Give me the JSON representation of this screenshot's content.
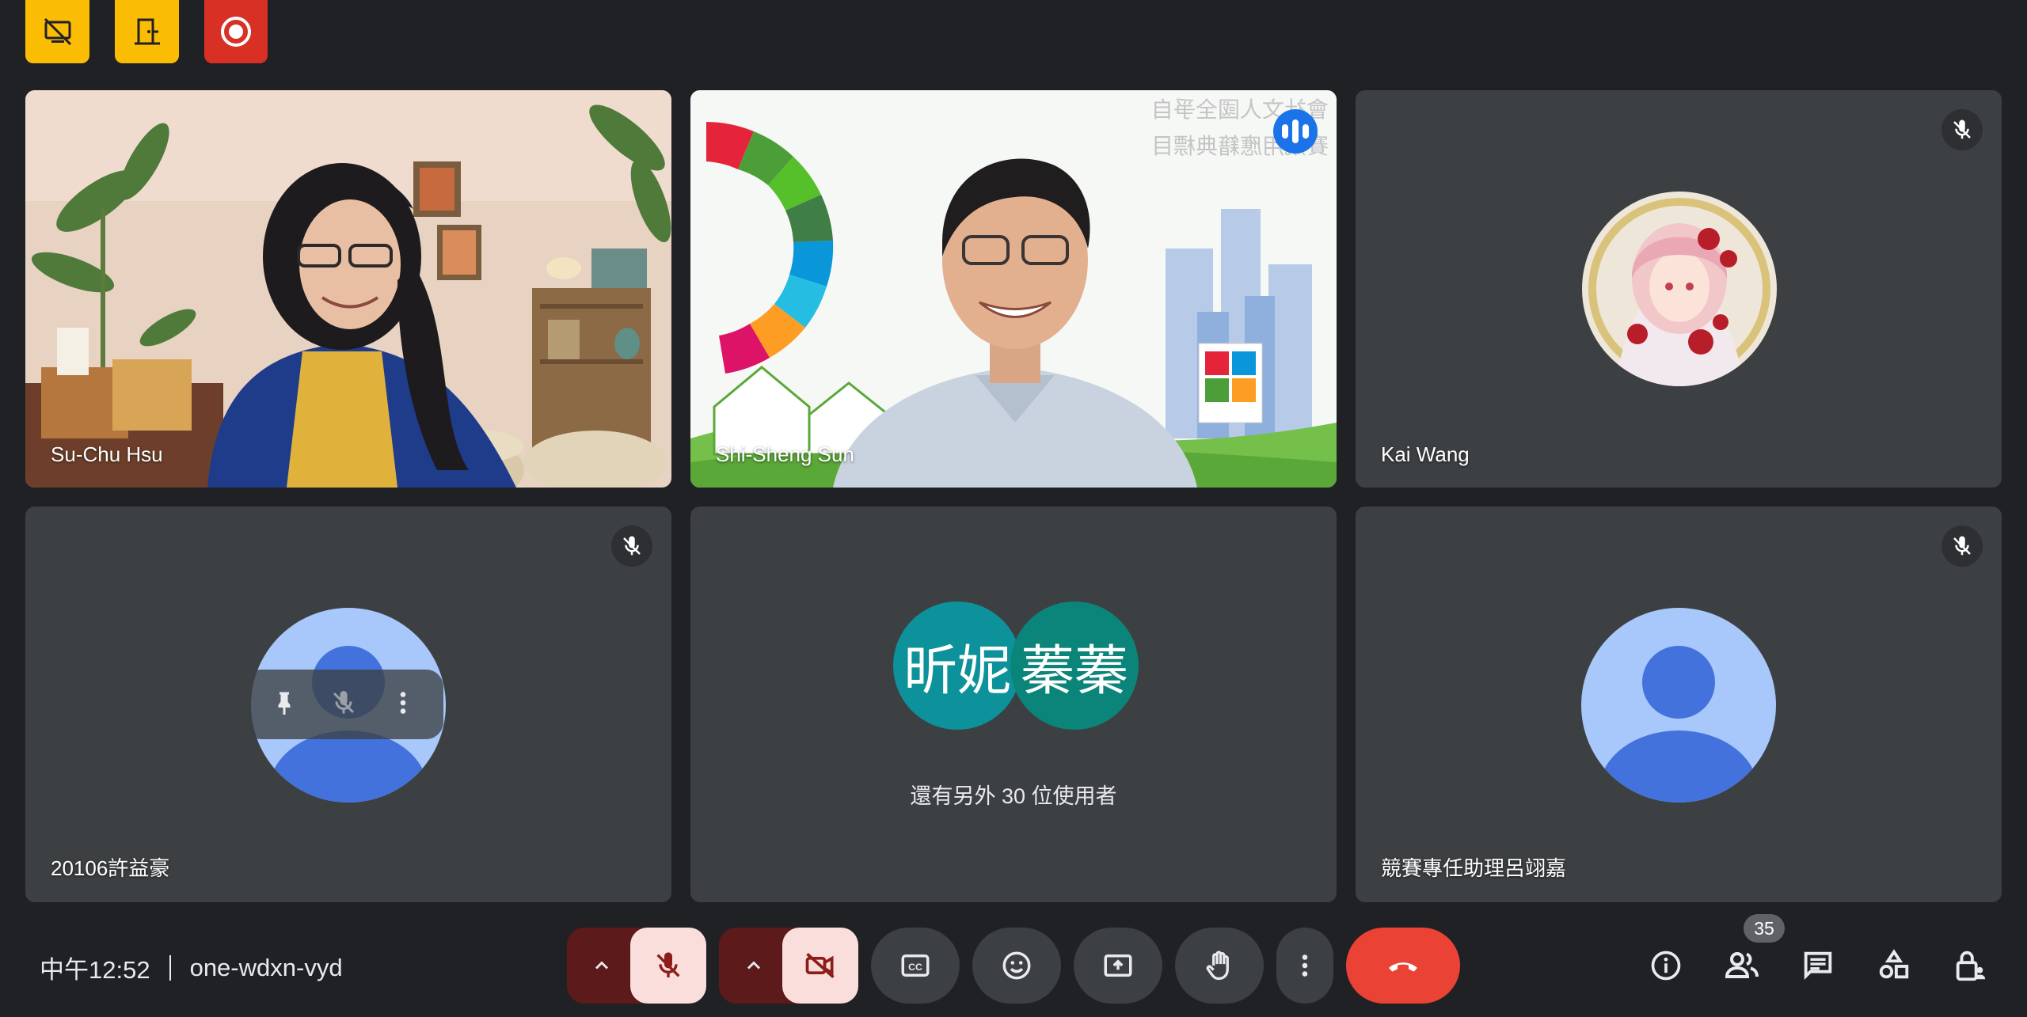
{
  "meeting": {
    "time": "中午12:52",
    "code": "one-wdxn-vyd",
    "participant_count": "35"
  },
  "indicators": [
    {
      "icon": "no-screen-share-icon",
      "color": "#fbbc04"
    },
    {
      "icon": "host-controls-icon",
      "color": "#fbbc04"
    },
    {
      "icon": "recording-icon",
      "color": "#d93025"
    }
  ],
  "tiles": {
    "t1": {
      "name": "Su-Chu Hsu"
    },
    "t2": {
      "name": "Shi-Sheng Sun",
      "speaking": true,
      "backdrop_text": [
        "會社文人國全爭自",
        "賽競用應籍典標目"
      ]
    },
    "t3": {
      "name": "Kai Wang",
      "muted": true
    },
    "t4": {
      "name": "20106許益豪",
      "muted": true
    },
    "t5": {
      "initials": [
        "昕妮",
        "蓁蓁"
      ],
      "others_label": "還有另外 30 位使用者"
    },
    "t6": {
      "name": "競賽專任助理呂翊嘉",
      "muted": true
    }
  },
  "controls": {
    "mic": "microphone-muted",
    "camera": "camera-off",
    "captions": "closed-captions",
    "reactions": "emoji",
    "present": "present-screen",
    "raise_hand": "raise-hand",
    "more": "more-options",
    "leave": "leave-call"
  },
  "colors": {
    "background": "#202124",
    "tile": "#3c4043",
    "accent": "#8ab4f8",
    "end_call": "#ea4335",
    "initials_a": "#0d929b",
    "initials_b": "#0b8579"
  }
}
